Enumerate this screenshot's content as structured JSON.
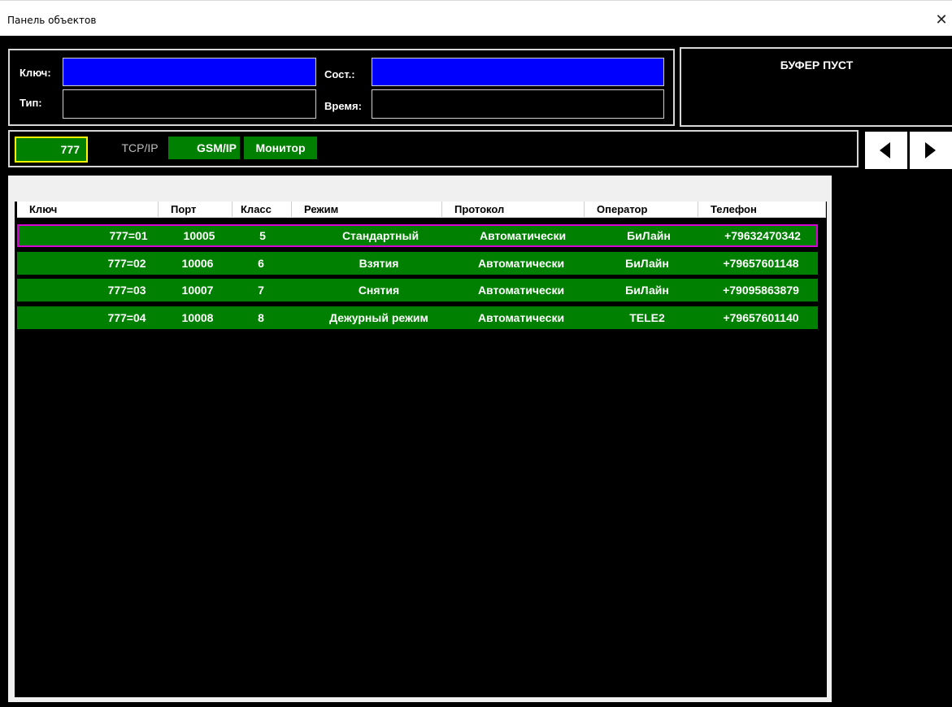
{
  "window": {
    "title": "Панель объектов",
    "close_label": "✕"
  },
  "info": {
    "key_label": "Ключ:",
    "key_value": "",
    "type_label": "Тип:",
    "type_value": "",
    "state_label": "Сост.:",
    "state_value": "",
    "time_label": "Время:",
    "time_value": ""
  },
  "buffer": {
    "message": "БУФЕР ПУСТ"
  },
  "filter": {
    "key_value": "777",
    "modes": [
      "TCP/IP",
      "GSM/IP",
      "Монитор"
    ]
  },
  "nav": {
    "prev_icon": "triangle-left-icon",
    "next_icon": "triangle-right-icon"
  },
  "table": {
    "columns": [
      "Ключ",
      "Порт",
      "Класс",
      "Режим",
      "Протокол",
      "Оператор",
      "Телефон"
    ],
    "rows": [
      {
        "key": "777=01",
        "port": "10005",
        "class": "5",
        "mode": "Стандартный",
        "protocol": "Автоматически",
        "operator": "БиЛайн",
        "phone": "+79632470342",
        "selected": true
      },
      {
        "key": "777=02",
        "port": "10006",
        "class": "6",
        "mode": "Взятия",
        "protocol": "Автоматически",
        "operator": "БиЛайн",
        "phone": "+79657601148"
      },
      {
        "key": "777=03",
        "port": "10007",
        "class": "7",
        "mode": "Снятия",
        "protocol": "Автоматически",
        "operator": "БиЛайн",
        "phone": "+79095863879"
      },
      {
        "key": "777=04",
        "port": "10008",
        "class": "8",
        "mode": "Дежурный режим",
        "protocol": "Автоматически",
        "operator": "TELE2",
        "phone": "+79657601140"
      }
    ]
  },
  "colors": {
    "row_green": "#008000",
    "selected_border": "#d400d4",
    "field_blue": "#0000ff",
    "key_border": "#ffff00"
  }
}
